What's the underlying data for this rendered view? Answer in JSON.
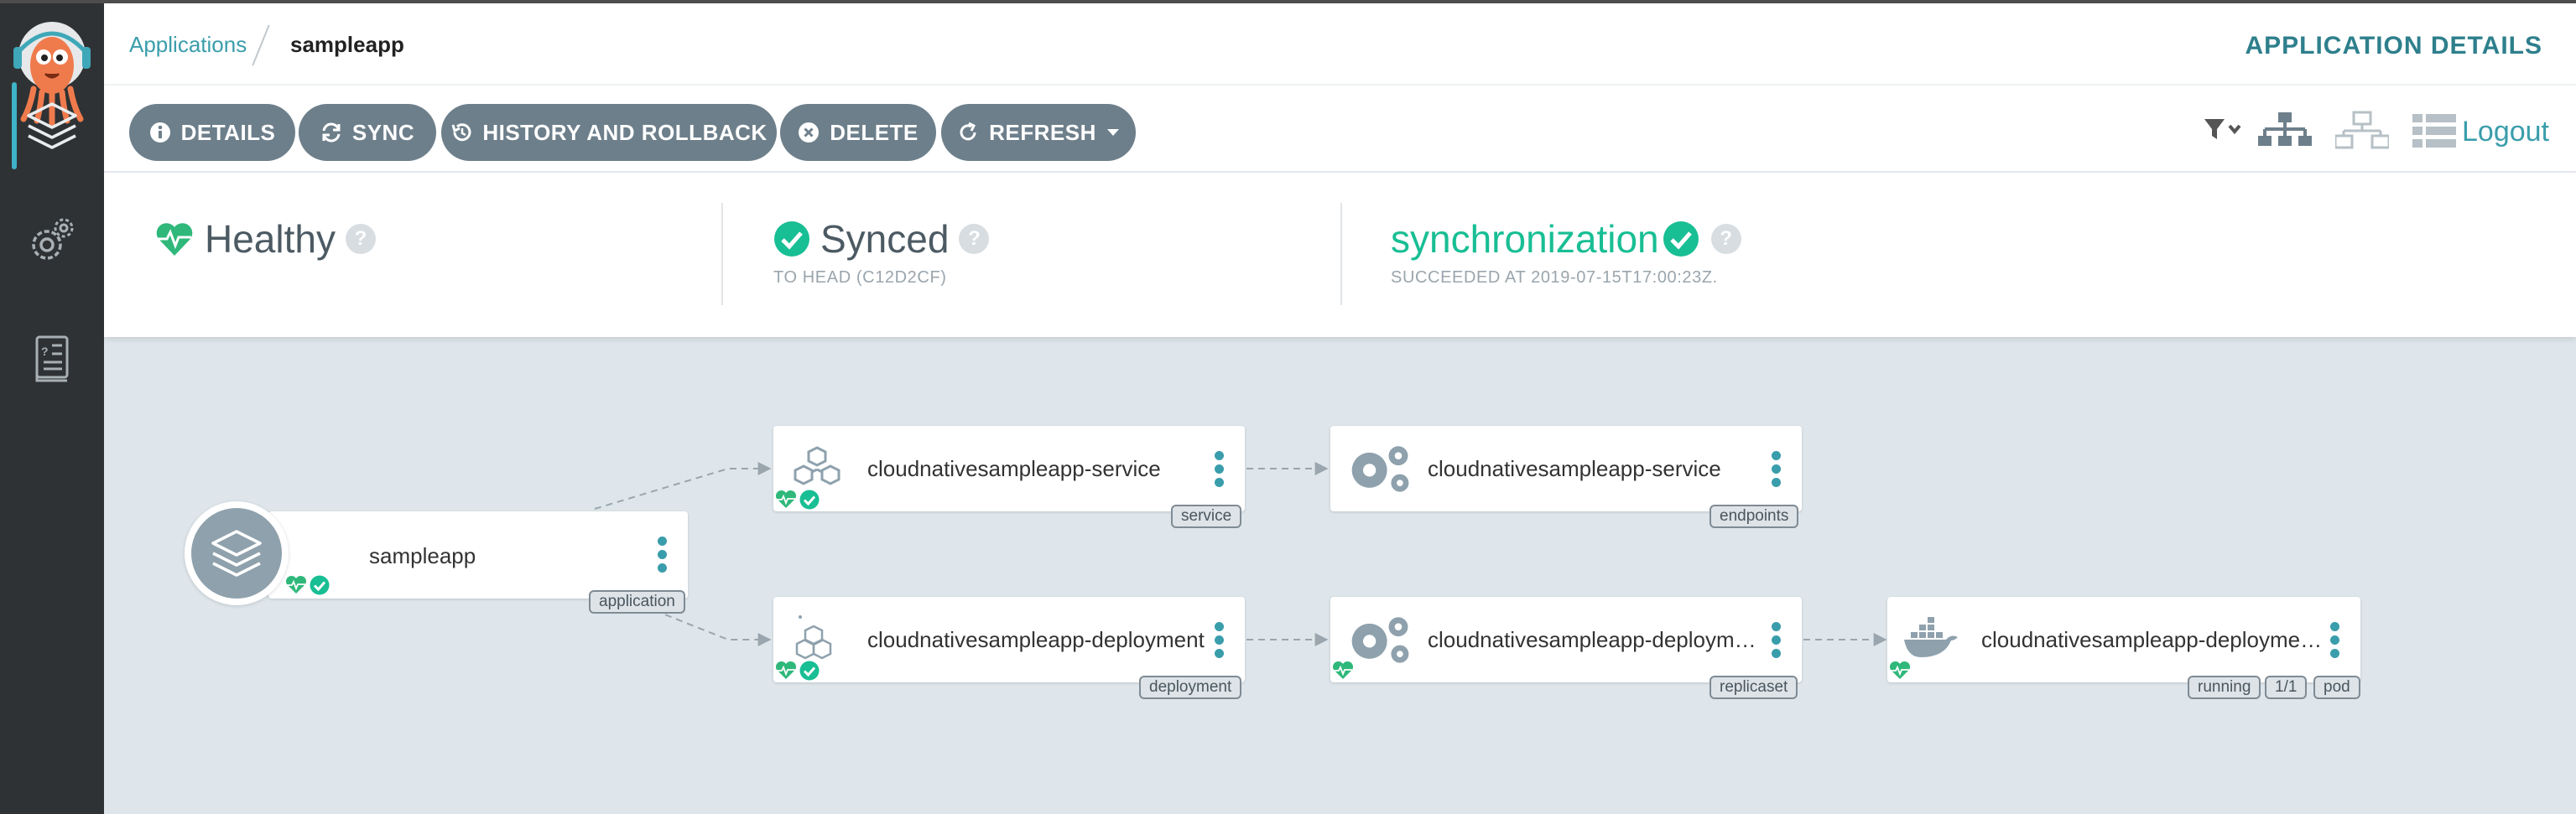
{
  "breadcrumb": {
    "parent": "Applications",
    "current": "sampleapp"
  },
  "page_heading": "APPLICATION DETAILS",
  "toolbar": {
    "details": "DETAILS",
    "sync": "SYNC",
    "history": "HISTORY AND ROLLBACK",
    "delete": "DELETE",
    "refresh": "REFRESH",
    "logout": "Logout"
  },
  "status": {
    "health": {
      "label": "Healthy"
    },
    "sync": {
      "label": "Synced",
      "sub": "TO HEAD (C12D2CF)"
    },
    "operation": {
      "label": "synchronization",
      "sub": "SUCCEEDED AT 2019-07-15T17:00:23Z."
    }
  },
  "graph": {
    "app": {
      "name": "sampleapp",
      "kind": "application"
    },
    "service": {
      "name": "cloudnativesampleapp-service",
      "kind": "service"
    },
    "endpoints": {
      "name": "cloudnativesampleapp-service",
      "kind": "endpoints"
    },
    "deployment": {
      "name": "cloudnativesampleapp-deployment",
      "kind": "deployment"
    },
    "replicaset": {
      "name": "cloudnativesampleapp-deploymen...",
      "kind": "replicaset"
    },
    "pod": {
      "name": "cloudnativesampleapp-deploymen...",
      "status": "running",
      "ready": "1/1",
      "kind": "pod"
    }
  },
  "colors": {
    "accent": "#3a9dab",
    "healthy": "#2fb87a",
    "synced": "#18be94",
    "button": "#6d7f8b",
    "sidebar": "#2f3234",
    "canvas": "#dee6eb"
  }
}
